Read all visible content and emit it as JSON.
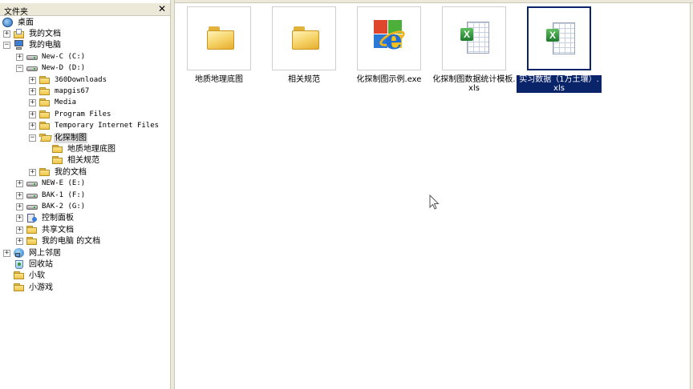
{
  "folder_pane": {
    "title": "文件夹",
    "close_glyph": "✕"
  },
  "tree": [
    {
      "label": "桌面",
      "icon": "desktop-icon",
      "expander": "",
      "level": 0
    },
    {
      "label": "我的文档",
      "icon": "documents-icon",
      "expander": "+",
      "level": 1
    },
    {
      "label": "我的电脑",
      "icon": "computer-icon",
      "expander": "−",
      "level": 1
    },
    {
      "label": "New-C (C:)",
      "icon": "drive-icon",
      "expander": "+",
      "level": 2,
      "mono": true
    },
    {
      "label": "New-D (D:)",
      "icon": "drive-icon",
      "expander": "−",
      "level": 2,
      "mono": true
    },
    {
      "label": "360Downloads",
      "icon": "folder-icon",
      "expander": "+",
      "level": 3,
      "mono": true
    },
    {
      "label": "mapgis67",
      "icon": "folder-icon",
      "expander": "+",
      "level": 3,
      "mono": true
    },
    {
      "label": "Media",
      "icon": "folder-icon",
      "expander": "+",
      "level": 3,
      "mono": true
    },
    {
      "label": "Program Files",
      "icon": "folder-icon",
      "expander": "+",
      "level": 3,
      "mono": true
    },
    {
      "label": "Temporary Internet Files",
      "icon": "folder-icon",
      "expander": "+",
      "level": 3,
      "mono": true
    },
    {
      "label": "化探制图",
      "icon": "folder-open-icon",
      "expander": "−",
      "level": 3,
      "selected": true
    },
    {
      "label": "地质地理底图",
      "icon": "folder-icon",
      "expander": "",
      "level": 4
    },
    {
      "label": "相关规范",
      "icon": "folder-icon",
      "expander": "",
      "level": 4
    },
    {
      "label": "我的文档",
      "icon": "folder-icon",
      "expander": "+",
      "level": 3
    },
    {
      "label": "NEW-E (E:)",
      "icon": "drive-icon",
      "expander": "+",
      "level": 2,
      "mono": true
    },
    {
      "label": "BAK-1 (F:)",
      "icon": "drive-icon",
      "expander": "+",
      "level": 2,
      "mono": true
    },
    {
      "label": "BAK-2 (G:)",
      "icon": "drive-icon",
      "expander": "+",
      "level": 2,
      "mono": true
    },
    {
      "label": "控制面板",
      "icon": "control-panel-icon",
      "expander": "+",
      "level": 2
    },
    {
      "label": "共享文档",
      "icon": "folder-icon",
      "expander": "+",
      "level": 2
    },
    {
      "label": "我的电脑 的文档",
      "icon": "folder-icon",
      "expander": "+",
      "level": 2
    },
    {
      "label": "网上邻居",
      "icon": "network-icon",
      "expander": "+",
      "level": 1
    },
    {
      "label": "回收站",
      "icon": "recycle-bin-icon",
      "expander": "",
      "level": 1
    },
    {
      "label": "小软",
      "icon": "folder-icon",
      "expander": "",
      "level": 1
    },
    {
      "label": "小游戏",
      "icon": "folder-icon",
      "expander": "",
      "level": 1
    }
  ],
  "files": [
    {
      "name": "地质地理底图",
      "type": "folder",
      "icon": "folder-icon"
    },
    {
      "name": "相关规范",
      "type": "folder",
      "icon": "folder-icon"
    },
    {
      "name": "化探制图示例.exe",
      "type": "exe",
      "icon": "internet-explorer-icon"
    },
    {
      "name": "化探制图数据统计模板.xls",
      "type": "xls",
      "icon": "excel-icon"
    },
    {
      "name": "实习数据（1万土壤）.xls",
      "type": "xls",
      "icon": "excel-icon",
      "selected": true
    }
  ],
  "colors": {
    "selection": "#0a246a",
    "chrome": "#ece9d8",
    "folder": "#f0c64a"
  }
}
